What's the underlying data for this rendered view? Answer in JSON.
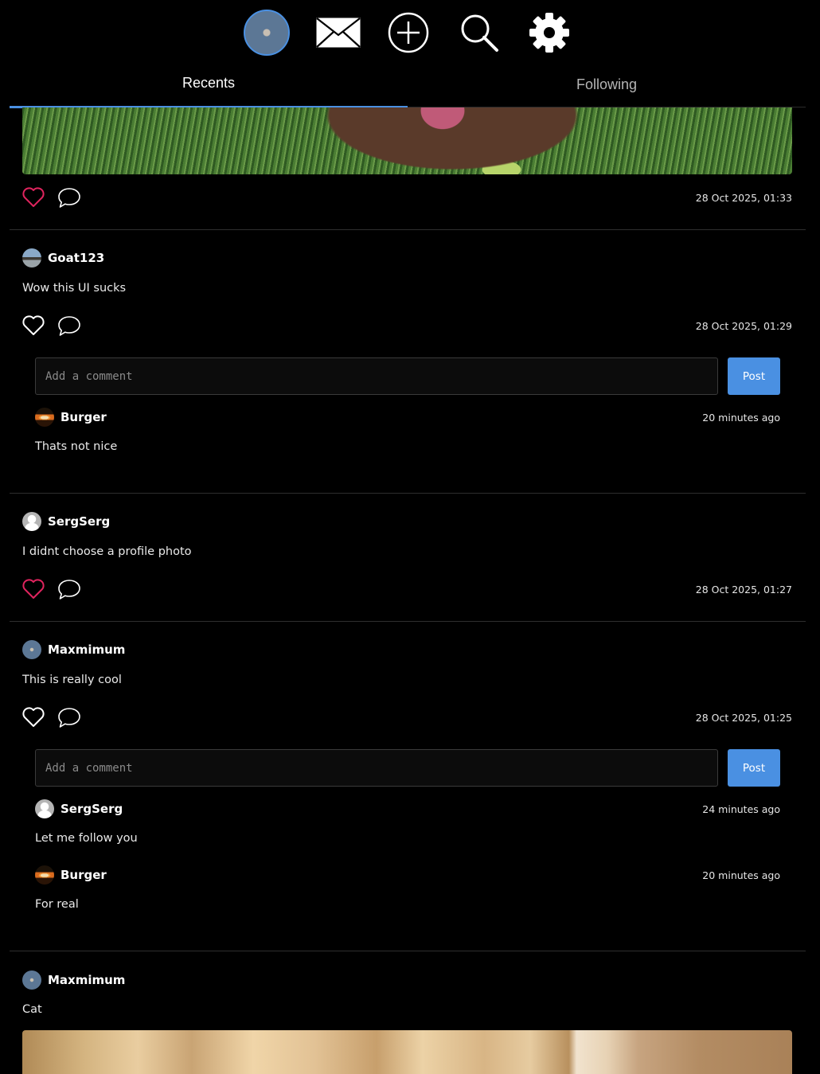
{
  "nav": {
    "icons": [
      "profile-avatar",
      "mail-icon",
      "create-post-icon",
      "search-icon",
      "settings-icon"
    ]
  },
  "tabs": {
    "recents": "Recents",
    "following": "Following"
  },
  "colors": {
    "accent": "#4a90e2",
    "heart_liked": "#e0245e",
    "background": "#000000"
  },
  "posts": [
    {
      "timestamp": "28 Oct 2025, 01:33",
      "liked": true
    },
    {
      "username": "Goat123",
      "text": "Wow this UI sucks",
      "timestamp": "28 Oct 2025, 01:29",
      "liked": false,
      "comment_placeholder": "Add a comment",
      "post_button": "Post",
      "comments": [
        {
          "username": "Burger",
          "time": "20 minutes ago",
          "text": "Thats not nice"
        }
      ]
    },
    {
      "username": "SergSerg",
      "text": "I didnt choose a profile photo",
      "timestamp": "28 Oct 2025, 01:27",
      "liked": true
    },
    {
      "username": "Maxmimum",
      "text": "This is really cool",
      "timestamp": "28 Oct 2025, 01:25",
      "liked": false,
      "comment_placeholder": "Add a comment",
      "post_button": "Post",
      "comments": [
        {
          "username": "SergSerg",
          "time": "24 minutes ago",
          "text": "Let me follow you"
        },
        {
          "username": "Burger",
          "time": "20 minutes ago",
          "text": "For real"
        }
      ]
    },
    {
      "username": "Maxmimum",
      "text": "Cat"
    }
  ]
}
